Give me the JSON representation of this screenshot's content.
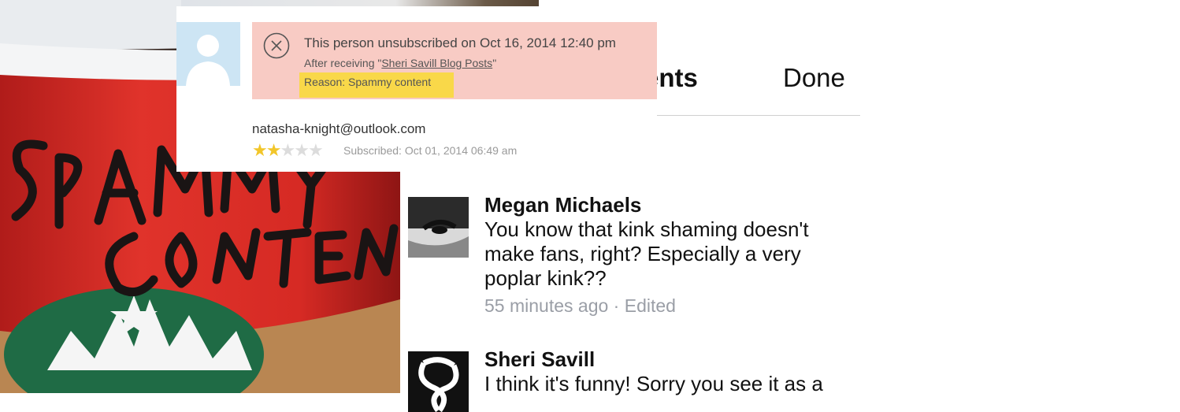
{
  "photo": {
    "caption": "SPAMMY CONTENT"
  },
  "comments_panel": {
    "header_title": "ents",
    "done_label": "Done",
    "comments": [
      {
        "author": "Megan Michaels",
        "text": "You know that kink shaming doesn't make fans, right? Especially a very poplar kink??",
        "time": "55 minutes ago",
        "separator": " · ",
        "edited": "Edited"
      },
      {
        "author": "Sheri Savill",
        "text": "I think it's funny! Sorry you see it as a",
        "time": "",
        "separator": "",
        "edited": ""
      }
    ]
  },
  "unsubscribe_card": {
    "status_line": "This person unsubscribed on Oct 16, 2014 12:40 pm",
    "after_prefix": "After receiving \"",
    "campaign_link": "Sheri Savill Blog Posts",
    "after_suffix": "\"",
    "reason": "Reason: Spammy content",
    "email": "natasha-knight@outlook.com",
    "rating_stars": 2,
    "rating_max": 5,
    "subscribed": "Subscribed: Oct 01, 2014 06:49 am",
    "colors": {
      "alert_bg": "#f8cbc4",
      "highlight": "#f9d849",
      "star_on": "#f2c62a",
      "star_off": "#dcdcdc"
    }
  }
}
